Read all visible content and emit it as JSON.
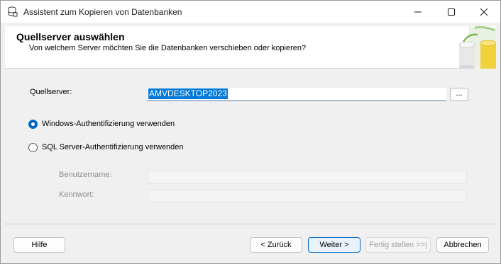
{
  "window": {
    "title": "Assistent zum Kopieren von Datenbanken"
  },
  "header": {
    "title": "Quellserver auswählen",
    "subtitle": "Von welchem Server möchten Sie die Datenbanken verschieben oder kopieren?"
  },
  "form": {
    "source_server_label": "Quellserver:",
    "source_server_value": "AMVDESKTOP2023",
    "browse_label": "...",
    "auth_windows_label": "Windows-Authentifizierung verwenden",
    "auth_windows_selected": true,
    "auth_sql_label": "SQL Server-Authentifizierung verwenden",
    "auth_sql_selected": false,
    "username_label": "Benutzername:",
    "username_value": "",
    "password_label": "Kennwort:",
    "password_value": ""
  },
  "footer": {
    "help_label": "Hilfe",
    "back_label": "< Zurück",
    "next_label": "Weiter >",
    "finish_label": "Fertig stellen >>|",
    "cancel_label": "Abbrechen"
  },
  "colors": {
    "accent": "#0067c0",
    "selection": "#0078d7"
  },
  "icons": {
    "title": "database-icon",
    "minimize": "minimize-icon",
    "maximize": "maximize-icon",
    "close": "close-icon",
    "header_art": "database-cylinders-icon"
  }
}
